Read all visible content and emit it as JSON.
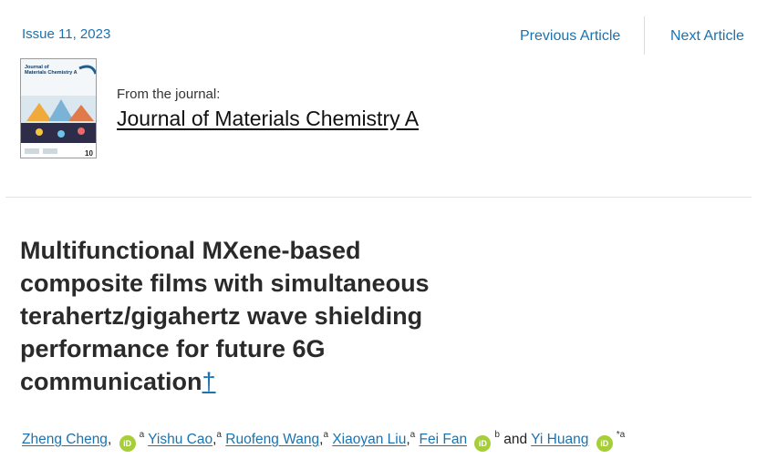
{
  "header": {
    "issue": "Issue 11, 2023",
    "previous_article": "Previous Article",
    "next_article": "Next Article"
  },
  "journal": {
    "cover_title": "Journal of Materials Chemistry A",
    "from_label": "From the journal:",
    "name": "Journal of Materials Chemistry A"
  },
  "article": {
    "title_lines": [
      "Multifunctional MXene-based",
      "composite films with simultaneous",
      "terahertz/gigahertz wave shielding",
      "performance for future 6G",
      "communication"
    ],
    "dagger": "†"
  },
  "authors": [
    {
      "name": "Zheng Cheng",
      "orcid": true,
      "affil": "a"
    },
    {
      "name": "Yishu Cao",
      "orcid": false,
      "affil": "a"
    },
    {
      "name": "Ruofeng Wang",
      "orcid": false,
      "affil": "a"
    },
    {
      "name": "Xiaoyan Liu",
      "orcid": false,
      "affil": "a"
    },
    {
      "name": "Fei Fan",
      "orcid": true,
      "affil": "b"
    },
    {
      "name": "Yi Huang",
      "orcid": true,
      "affil": "*a"
    }
  ],
  "authors_and": "and",
  "orcid_label": "iD",
  "colors": {
    "link": "#1a73b0",
    "orcid": "#a6ce39"
  }
}
